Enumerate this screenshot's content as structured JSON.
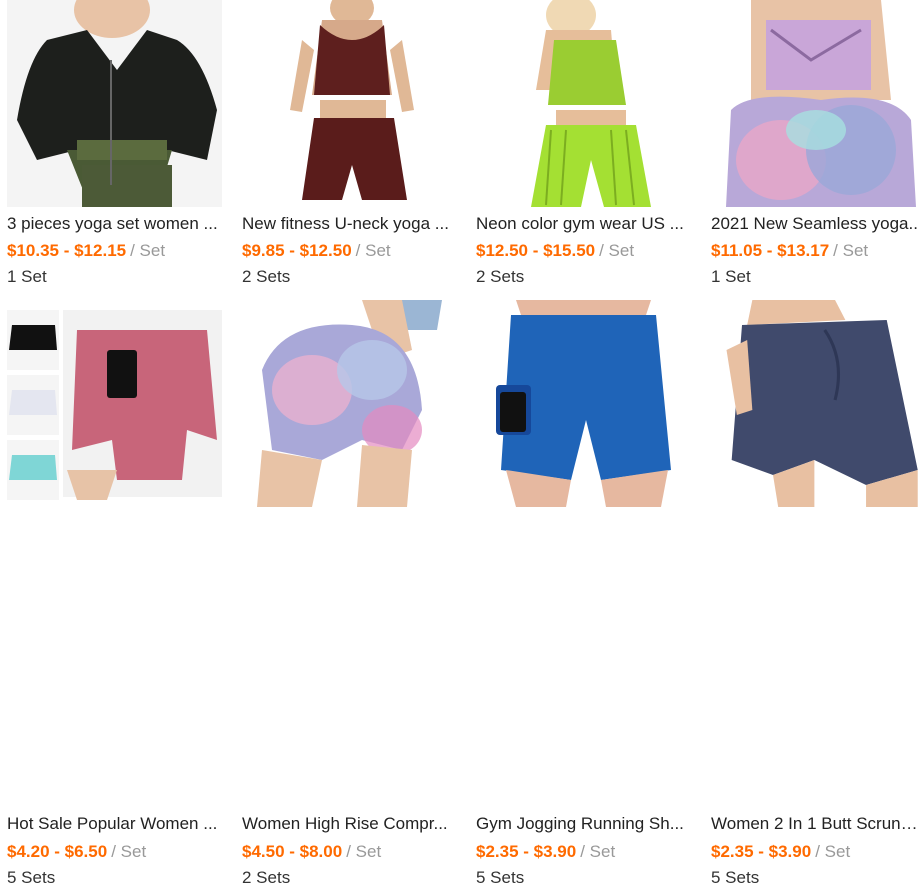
{
  "products": [
    {
      "title": "3 pieces yoga set women ...",
      "price": "$10.35 - $12.15",
      "unit": "/ Set",
      "moq": "1 Set",
      "image_icon": "product-image-yoga-set-black-green"
    },
    {
      "title": "New fitness U-neck yoga ...",
      "price": "$9.85 - $12.50",
      "unit": "/ Set",
      "moq": "2 Sets",
      "image_icon": "product-image-yoga-set-maroon"
    },
    {
      "title": "Neon color gym wear US ...",
      "price": "$12.50 - $15.50",
      "unit": "/ Set",
      "moq": "2 Sets",
      "image_icon": "product-image-neon-gym-wear"
    },
    {
      "title": "2021 New Seamless yoga...",
      "price": "$11.05 - $13.17",
      "unit": "/ Set",
      "moq": "1 Set",
      "image_icon": "product-image-tie-dye-seamless-set"
    },
    {
      "title": "Hot Sale Popular Women ...",
      "price": "$4.20 - $6.50",
      "unit": "/ Set",
      "moq": "5 Sets",
      "image_icon": "product-image-tennis-skirts"
    },
    {
      "title": "Women High Rise Compr...",
      "price": "$4.50 - $8.00",
      "unit": "/ Set",
      "moq": "2 Sets",
      "image_icon": "product-image-tie-dye-shorts"
    },
    {
      "title": "Gym Jogging Running Sh...",
      "price": "$2.35 - $3.90",
      "unit": "/ Set",
      "moq": "5 Sets",
      "image_icon": "product-image-blue-bike-shorts"
    },
    {
      "title": "Women 2 In 1 Butt Scrunc...",
      "price": "$2.35 - $3.90",
      "unit": "/ Set",
      "moq": "5 Sets",
      "image_icon": "product-image-navy-running-shorts"
    }
  ],
  "colors": {
    "price": "#ff6a00",
    "unit": "#999999",
    "text": "#222222"
  }
}
